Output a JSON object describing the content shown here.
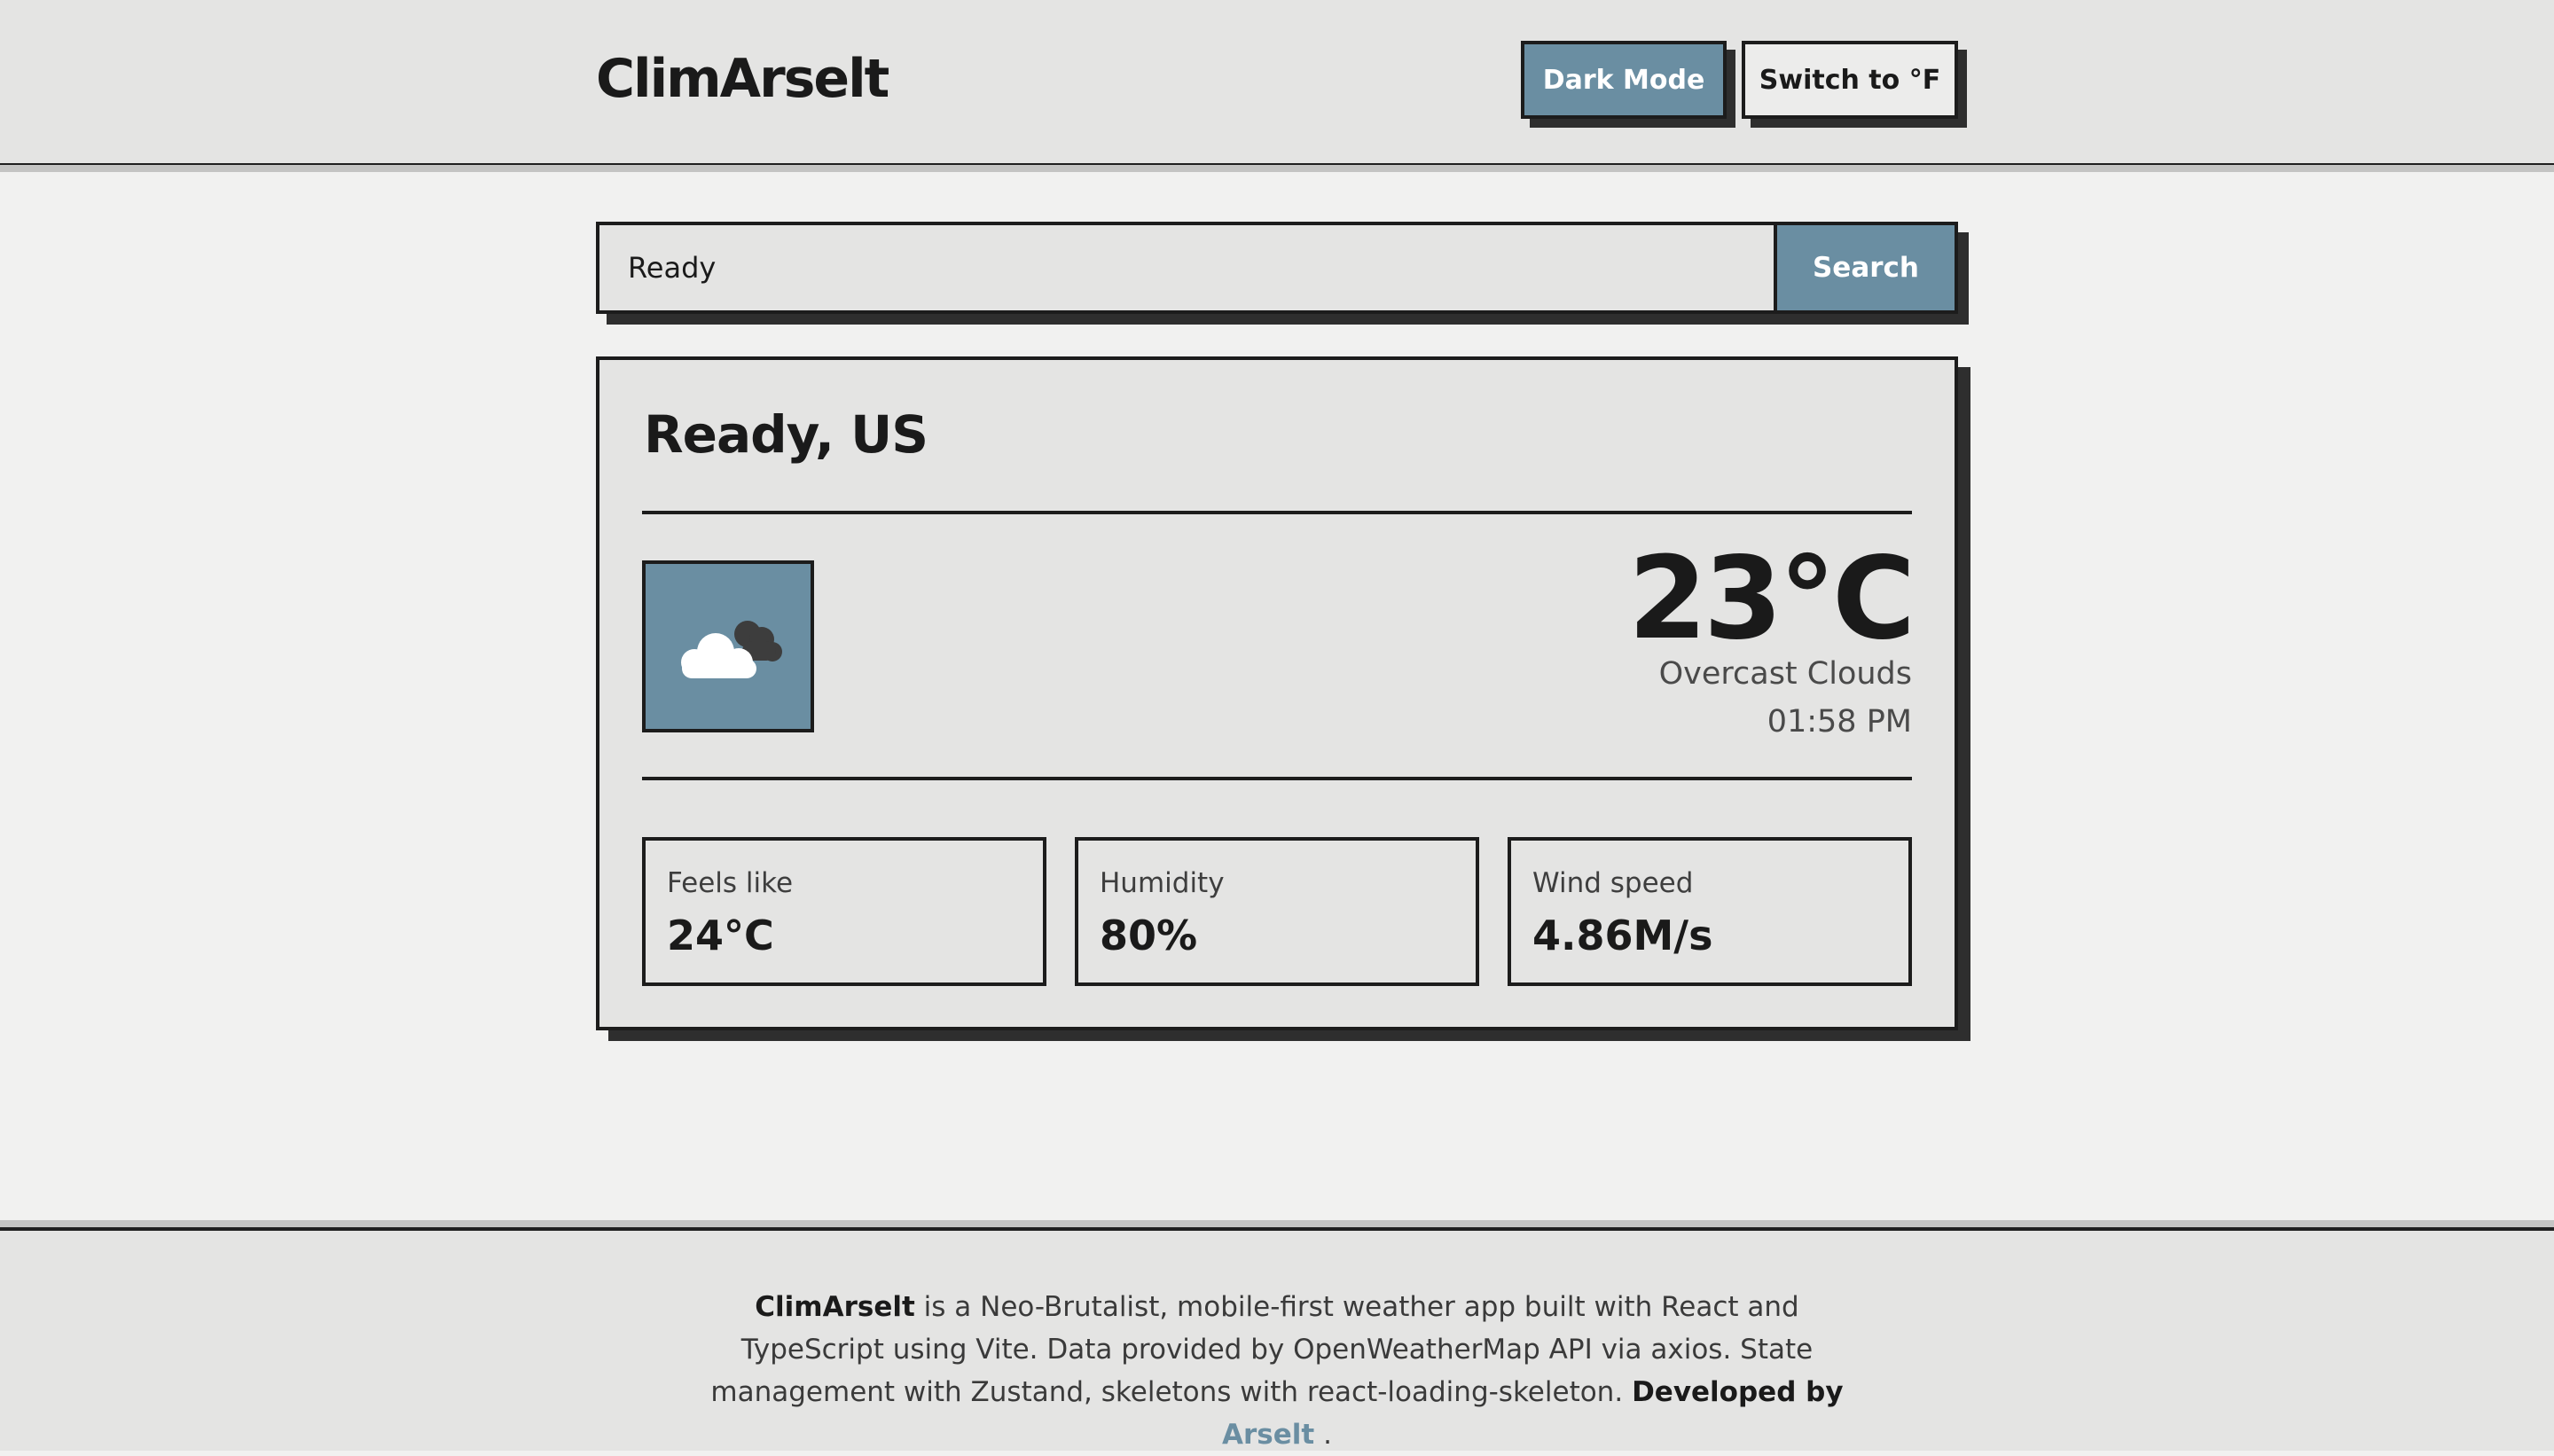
{
  "header": {
    "logo": "ClimArselt",
    "dark_mode_label": "Dark Mode",
    "unit_toggle_label": "Switch to °F"
  },
  "search": {
    "value": "Ready",
    "button_label": "Search"
  },
  "weather": {
    "location": "Ready, US",
    "icon": "overcast-clouds-icon",
    "temperature": "23°C",
    "description": "Overcast Clouds",
    "time": "01:58 PM",
    "stats": [
      {
        "label": "Feels like",
        "value": "24°C"
      },
      {
        "label": "Humidity",
        "value": "80%"
      },
      {
        "label": "Wind speed",
        "value": "4.86M/s"
      }
    ]
  },
  "footer": {
    "app_name": "ClimArselt",
    "description": "is a Neo-Brutalist, mobile-first weather app built with React and TypeScript using Vite. Data provided by OpenWeatherMap API via axios. State management with Zustand, skeletons with react-loading-skeleton.",
    "developed_by": "Developed by",
    "author": "Arselt",
    "trailing": "."
  },
  "colors": {
    "accent": "#6a8ea2",
    "background": "#f1f1f0",
    "surface": "#e4e4e3",
    "border": "#1c1c1c"
  }
}
